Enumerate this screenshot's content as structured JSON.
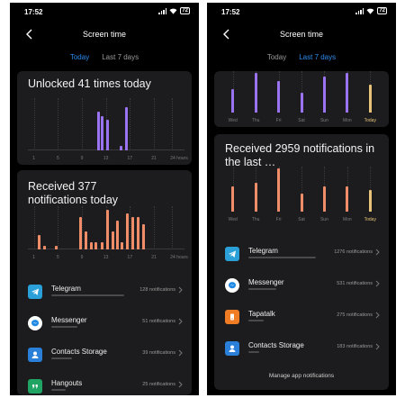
{
  "left": {
    "status": {
      "time": "17:52",
      "battery": "72"
    },
    "header": {
      "title": "Screen time"
    },
    "tabs": [
      {
        "label": "Today",
        "active": true
      },
      {
        "label": "Last 7 days",
        "active": false
      }
    ],
    "unlocks": {
      "title": "Unlocked 41 times today",
      "chart_data": {
        "type": "bar",
        "x_ticks": [
          "1",
          "5",
          "9",
          "13",
          "17",
          "21",
          "24 hours"
        ],
        "xlim": [
          0,
          24
        ],
        "bars": [
          {
            "hour": 11.5,
            "value": 9
          },
          {
            "hour": 12.2,
            "value": 8
          },
          {
            "hour": 13.0,
            "value": 7
          },
          {
            "hour": 15.3,
            "value": 1
          },
          {
            "hour": 16.2,
            "value": 10
          }
        ],
        "color": "#9a74f0"
      }
    },
    "notifications": {
      "title": "Received 377 notifications today",
      "chart_data": {
        "type": "bar",
        "x_ticks": [
          "1",
          "5",
          "9",
          "13",
          "17",
          "21",
          "24 hours"
        ],
        "xlim": [
          0,
          24
        ],
        "bars": [
          {
            "hour": 1.6,
            "value": 4
          },
          {
            "hour": 2.5,
            "value": 1
          },
          {
            "hour": 4.5,
            "value": 1
          },
          {
            "hour": 8.5,
            "value": 9
          },
          {
            "hour": 9.5,
            "value": 5
          },
          {
            "hour": 10.3,
            "value": 2
          },
          {
            "hour": 11.1,
            "value": 2
          },
          {
            "hour": 12.2,
            "value": 2
          },
          {
            "hour": 13.0,
            "value": 11
          },
          {
            "hour": 13.9,
            "value": 5
          },
          {
            "hour": 14.7,
            "value": 8
          },
          {
            "hour": 15.5,
            "value": 2
          },
          {
            "hour": 16.4,
            "value": 10
          },
          {
            "hour": 17.2,
            "value": 9
          },
          {
            "hour": 18.2,
            "value": 9
          },
          {
            "hour": 19.0,
            "value": 7
          }
        ],
        "color": "#ef8d69"
      }
    },
    "apps": [
      {
        "name": "Telegram",
        "count": "128 notifications",
        "icon": "telegram-icon",
        "color": "#2a9fd8",
        "share": 0.62
      },
      {
        "name": "Messenger",
        "count": "51 notifications",
        "icon": "messenger-icon",
        "color": "#ffffff",
        "share": 0.22
      },
      {
        "name": "Contacts Storage",
        "count": "39 notifications",
        "icon": "contacts-icon",
        "color": "#2a7fd8",
        "share": 0.18
      },
      {
        "name": "Hangouts",
        "count": "25 notifications",
        "icon": "hangouts-icon",
        "color": "#1fa463",
        "share": 0.12
      }
    ]
  },
  "right": {
    "status": {
      "time": "17:52",
      "battery": "72"
    },
    "header": {
      "title": "Screen time"
    },
    "tabs": [
      {
        "label": "Today",
        "active": false
      },
      {
        "label": "Last 7 days",
        "active": true
      }
    ],
    "unlocks_week": {
      "chart_data": {
        "type": "bar",
        "categories": [
          "Wed",
          "Thu",
          "Fri",
          "Sat",
          "Sun",
          "Mon",
          "Today"
        ],
        "values": [
          6,
          10,
          8,
          5,
          9,
          10,
          7
        ],
        "color": "#9a74f0",
        "today_color": "#e9c27a"
      }
    },
    "notifications_week": {
      "title": "Received 2959 notifications in the last …",
      "chart_data": {
        "type": "bar",
        "categories": [
          "Wed",
          "Thu",
          "Fri",
          "Sat",
          "Sun",
          "Mon",
          "Today"
        ],
        "values": [
          7,
          8,
          12,
          5,
          7,
          7,
          6
        ],
        "color": "#ef8d69",
        "today_color": "#e9c27a"
      }
    },
    "apps": [
      {
        "name": "Telegram",
        "count": "1276 notifications",
        "icon": "telegram-icon",
        "color": "#2a9fd8",
        "share": 0.58
      },
      {
        "name": "Messenger",
        "count": "531 notifications",
        "icon": "messenger-icon",
        "color": "#ffffff",
        "share": 0.24
      },
      {
        "name": "Tapatalk",
        "count": "275 notifications",
        "icon": "tapatalk-icon",
        "color": "#f07d24",
        "share": 0.13
      },
      {
        "name": "Contacts Storage",
        "count": "183 notifications",
        "icon": "contacts-icon",
        "color": "#2a7fd8",
        "share": 0.09
      }
    ],
    "footer": {
      "manage_label": "Manage app notifications"
    }
  }
}
